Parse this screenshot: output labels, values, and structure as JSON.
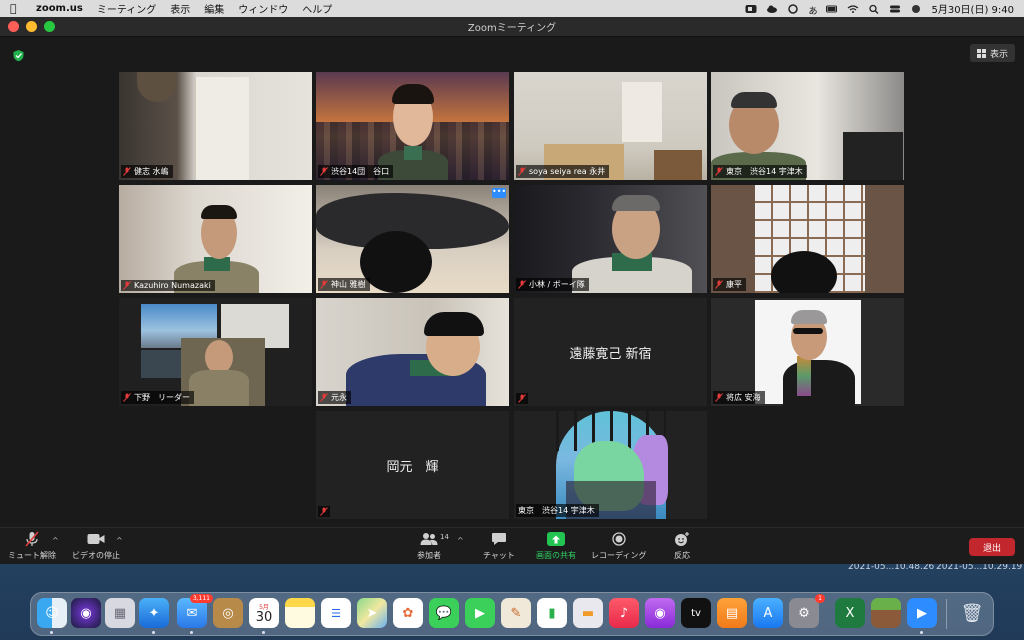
{
  "menubar": {
    "app_name": "zoom.us",
    "menus": [
      "ミーティング",
      "表示",
      "編集",
      "ウィンドウ",
      "ヘルプ"
    ],
    "date_time": "5月30日(日)  9:40",
    "ime": "あ"
  },
  "window": {
    "title": "Zoomミーティング",
    "view_label": "表示"
  },
  "participants": [
    {
      "name": "健志 水嶋",
      "muted": true
    },
    {
      "name": "渋谷14団　谷口",
      "muted": true
    },
    {
      "name": "soya seiya rea 永井",
      "muted": true
    },
    {
      "name": "東京　渋谷14 宇津木",
      "muted": true
    },
    {
      "name": "Kazuhiro Numazaki",
      "muted": true
    },
    {
      "name": "神山 雅樹",
      "muted": true
    },
    {
      "name": "小林 / ボーイ隊",
      "muted": true
    },
    {
      "name": "康平",
      "muted": true
    },
    {
      "name": "下野　リーダー",
      "muted": true
    },
    {
      "name": "元永",
      "muted": true
    },
    {
      "name": "遠藤寛己 新宿",
      "muted": true
    },
    {
      "name": "将広 安海",
      "muted": true
    },
    {
      "name": "岡元　輝",
      "muted": true
    },
    {
      "name": "東京　渋谷14 宇津木",
      "muted": false
    }
  ],
  "controls": {
    "mute": "ミュート解除",
    "video": "ビデオの停止",
    "participants": "参加者",
    "participants_count": "14",
    "chat": "チャット",
    "share": "画面の共有",
    "record": "レコーディング",
    "reactions": "反応",
    "leave": "退出"
  },
  "desktop_files": [
    "2021-05...10.48.26",
    "2021-05...10.29.19"
  ],
  "dock": {
    "mail_badge": "3,111",
    "calendar_month": "5月",
    "calendar_day": "30",
    "settings_badge": "1",
    "tv_label": "tv"
  },
  "colors": {
    "active_speaker": "#d9e06b",
    "share_green": "#23c552",
    "leave_red": "#c1272d",
    "mute_red": "#e23b3b"
  }
}
